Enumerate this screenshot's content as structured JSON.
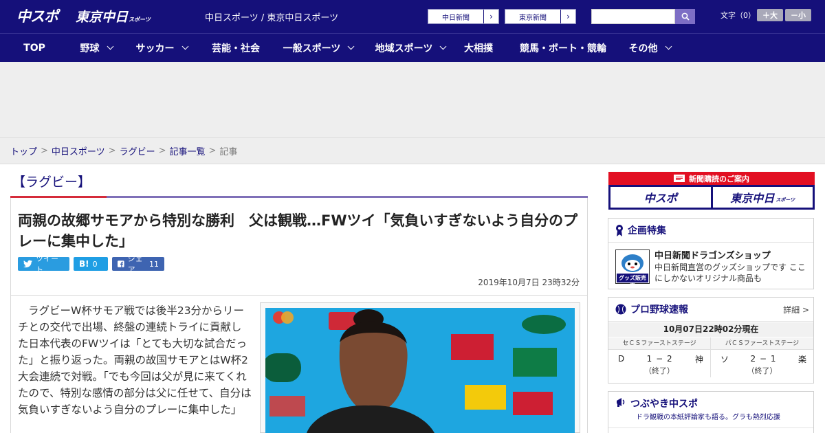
{
  "header": {
    "logo_chuspo": "中スポ",
    "logo_tokyo": "東京中日",
    "logo_tokyo_sub": "スポーツ",
    "site_title": "中日スポーツ / 東京中日スポーツ",
    "paper_buttons": [
      "中日新聞",
      "東京新聞"
    ],
    "arrow_glyph": "›",
    "search": {
      "placeholder": "",
      "icon": "search-icon"
    },
    "font_size": {
      "label": "文字（0）",
      "larger": "＋大",
      "smaller": "－小"
    }
  },
  "nav": [
    {
      "label": "TOP",
      "dropdown": false
    },
    {
      "label": "野球",
      "dropdown": true
    },
    {
      "label": "サッカー",
      "dropdown": true
    },
    {
      "label": "芸能・社会",
      "dropdown": false
    },
    {
      "label": "一般スポーツ",
      "dropdown": true
    },
    {
      "label": "地域スポーツ",
      "dropdown": true
    },
    {
      "label": "大相撲",
      "dropdown": false
    },
    {
      "label": "競馬・ボート・競輪",
      "dropdown": false
    },
    {
      "label": "その他",
      "dropdown": true
    }
  ],
  "breadcrumb": {
    "items": [
      "トップ",
      "中日スポーツ",
      "ラグビー",
      "記事一覧"
    ],
    "current": "記事",
    "separator": ">"
  },
  "article": {
    "section": "【ラグビー】",
    "headline": "両親の故郷サモアから特別な勝利　父は観戦…FWツイ「気負いすぎないよう自分のプレーに集中した」",
    "share": {
      "tweet": "ツイート",
      "hatena": "B!",
      "hatena_count": "0",
      "facebook": "シェア",
      "facebook_count": "11"
    },
    "date": "2019年10月7日 23時32分",
    "body": "ラグビーW杯サモア戦では後半23分からリーチとの交代で出場、終盤の連続トライに貢献した日本代表のFWツイは「とても大切な試合だった」と振り返った。両親の故国サモアとはW杯2大会連続で対戦。「でも今回は父が見に来てくれたので、特別な感情の部分は父に任せて、自分は気負いすぎないよう自分のプレーに集中した」"
  },
  "sidebar": {
    "subscribe": {
      "heading": "新聞購読のご案内",
      "logo_chuspo": "中スポ",
      "logo_tokyo": "東京中日",
      "logo_tokyo_sub": "スポーツ"
    },
    "special": {
      "title": "企画特集",
      "item_title": "中日新聞ドラゴンズショップ",
      "item_desc": "中日新聞直営のグッズショップです ここにしかないオリジナル商品も",
      "thumb_label": "グッズ販売中"
    },
    "baseball": {
      "title": "プロ野球速報",
      "more": "詳細 >",
      "as_of": "10月07日22時02分現在",
      "games": [
        {
          "stage": "セＣＳファーストステージ",
          "home": "D",
          "score": "1 − 2",
          "away": "神",
          "status": "（終了）"
        },
        {
          "stage": "パＣＳファーストステージ",
          "home": "ソ",
          "score": "2 − 1",
          "away": "楽",
          "status": "（終了）"
        }
      ]
    },
    "tweets": {
      "title": "つぶやき中スポ",
      "subtitle": "ドラ観戦の本紙評論家も語る。グラも熱烈応援"
    }
  },
  "colors": {
    "brand_navy": "#15107a",
    "accent_red": "#e20f22",
    "accent_purple": "#7f70b8",
    "twitter_blue": "#2a9ce0",
    "facebook_blue": "#3e64b1"
  }
}
